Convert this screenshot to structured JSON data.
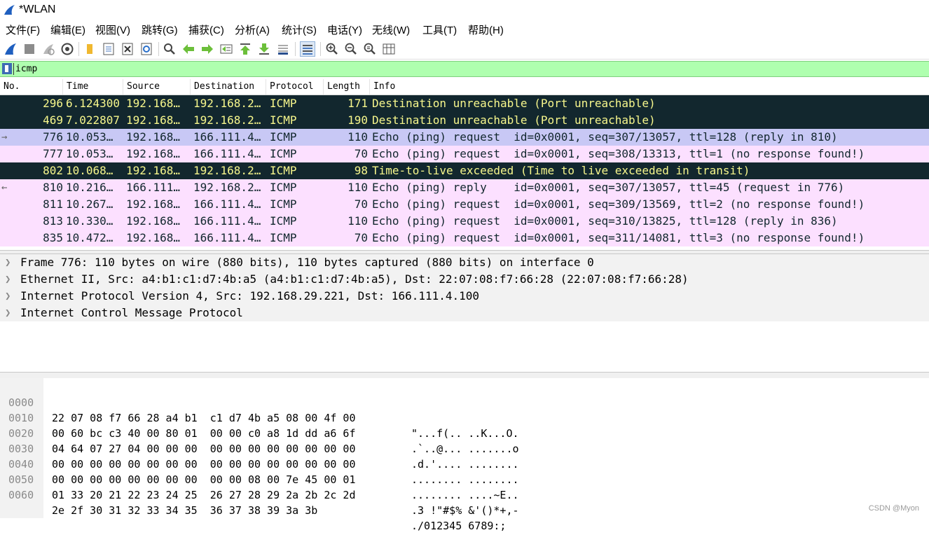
{
  "window": {
    "title": "*WLAN"
  },
  "menu": [
    "文件(F)",
    "编辑(E)",
    "视图(V)",
    "跳转(G)",
    "捕获(C)",
    "分析(A)",
    "统计(S)",
    "电话(Y)",
    "无线(W)",
    "工具(T)",
    "帮助(H)"
  ],
  "toolbar": {
    "icons": [
      "shark-fin-start-icon",
      "stop-capture-icon",
      "restart-capture-icon",
      "capture-options-icon",
      "open-file-icon",
      "save-file-icon",
      "close-file-icon",
      "reload-file-icon",
      "find-packet-icon",
      "go-back-icon",
      "go-forward-icon",
      "go-to-packet-icon",
      "go-first-icon",
      "go-last-icon",
      "auto-scroll-icon",
      "colorize-icon",
      "zoom-in-icon",
      "zoom-out-icon",
      "zoom-normal-icon",
      "resize-columns-icon"
    ]
  },
  "filter": {
    "value": "icmp"
  },
  "columns": [
    "No.",
    "Time",
    "Source",
    "Destination",
    "Protocol",
    "Length",
    "Info"
  ],
  "packets": [
    {
      "no": "296",
      "time": "6.124300",
      "source": "192.168…",
      "destination": "192.168.2…",
      "protocol": "ICMP",
      "length": "171",
      "info": "Destination unreachable (Port unreachable)",
      "style": "dark",
      "mark": ""
    },
    {
      "no": "469",
      "time": "7.022807",
      "source": "192.168…",
      "destination": "192.168.2…",
      "protocol": "ICMP",
      "length": "190",
      "info": "Destination unreachable (Port unreachable)",
      "style": "dark",
      "mark": ""
    },
    {
      "no": "776",
      "time": "10.053…",
      "source": "192.168…",
      "destination": "166.111.4…",
      "protocol": "ICMP",
      "length": "110",
      "info": "Echo (ping) request  id=0x0001, seq=307/13057, ttl=128 (reply in 810)",
      "style": "sel",
      "mark": "→"
    },
    {
      "no": "777",
      "time": "10.053…",
      "source": "192.168…",
      "destination": "166.111.4…",
      "protocol": "ICMP",
      "length": "70",
      "info": "Echo (ping) request  id=0x0001, seq=308/13313, ttl=1 (no response found!)",
      "style": "pink",
      "mark": ""
    },
    {
      "no": "802",
      "time": "10.068…",
      "source": "192.168…",
      "destination": "192.168.2…",
      "protocol": "ICMP",
      "length": "98",
      "info": "Time-to-live exceeded (Time to live exceeded in transit)",
      "style": "dark",
      "mark": ""
    },
    {
      "no": "810",
      "time": "10.216…",
      "source": "166.111…",
      "destination": "192.168.2…",
      "protocol": "ICMP",
      "length": "110",
      "info": "Echo (ping) reply    id=0x0001, seq=307/13057, ttl=45 (request in 776)",
      "style": "pink",
      "mark": "←"
    },
    {
      "no": "811",
      "time": "10.267…",
      "source": "192.168…",
      "destination": "166.111.4…",
      "protocol": "ICMP",
      "length": "70",
      "info": "Echo (ping) request  id=0x0001, seq=309/13569, ttl=2 (no response found!)",
      "style": "pink",
      "mark": ""
    },
    {
      "no": "813",
      "time": "10.330…",
      "source": "192.168…",
      "destination": "166.111.4…",
      "protocol": "ICMP",
      "length": "110",
      "info": "Echo (ping) request  id=0x0001, seq=310/13825, ttl=128 (reply in 836)",
      "style": "pink",
      "mark": ""
    },
    {
      "no": "835",
      "time": "10.472…",
      "source": "192.168…",
      "destination": "166.111.4…",
      "protocol": "ICMP",
      "length": "70",
      "info": "Echo (ping) request  id=0x0001, seq=311/14081, ttl=3 (no response found!)",
      "style": "pink",
      "mark": ""
    }
  ],
  "details": [
    "Frame 776: 110 bytes on wire (880 bits), 110 bytes captured (880 bits) on interface 0",
    "Ethernet II, Src: a4:b1:c1:d7:4b:a5 (a4:b1:c1:d7:4b:a5), Dst: 22:07:08:f7:66:28 (22:07:08:f7:66:28)",
    "Internet Protocol Version 4, Src: 192.168.29.221, Dst: 166.111.4.100",
    "Internet Control Message Protocol"
  ],
  "hex": [
    {
      "offset": "0000",
      "bytes": "22 07 08 f7 66 28 a4 b1  c1 d7 4b a5 08 00 4f 00",
      "ascii": "\"...f(.. ..K...O."
    },
    {
      "offset": "0010",
      "bytes": "00 60 bc c3 40 00 80 01  00 00 c0 a8 1d dd a6 6f",
      "ascii": ".`..@... .......o"
    },
    {
      "offset": "0020",
      "bytes": "04 64 07 27 04 00 00 00  00 00 00 00 00 00 00 00",
      "ascii": ".d.'.... ........"
    },
    {
      "offset": "0030",
      "bytes": "00 00 00 00 00 00 00 00  00 00 00 00 00 00 00 00",
      "ascii": "........ ........"
    },
    {
      "offset": "0040",
      "bytes": "00 00 00 00 00 00 00 00  00 00 08 00 7e 45 00 01",
      "ascii": "........ ....~E.."
    },
    {
      "offset": "0050",
      "bytes": "01 33 20 21 22 23 24 25  26 27 28 29 2a 2b 2c 2d",
      "ascii": ".3 !\"#$% &'()*+,-"
    },
    {
      "offset": "0060",
      "bytes": "2e 2f 30 31 32 33 34 35  36 37 38 39 3a 3b",
      "ascii": "./012345 6789:;"
    }
  ],
  "watermark": "CSDN @Myon⁠",
  "colors": {
    "dark_row": "#12272e",
    "dark_text": "#f7f78c",
    "pink_row": "#fce0ff",
    "selected_row": "#c8c8f5",
    "filter_bg": "#afffaf"
  }
}
